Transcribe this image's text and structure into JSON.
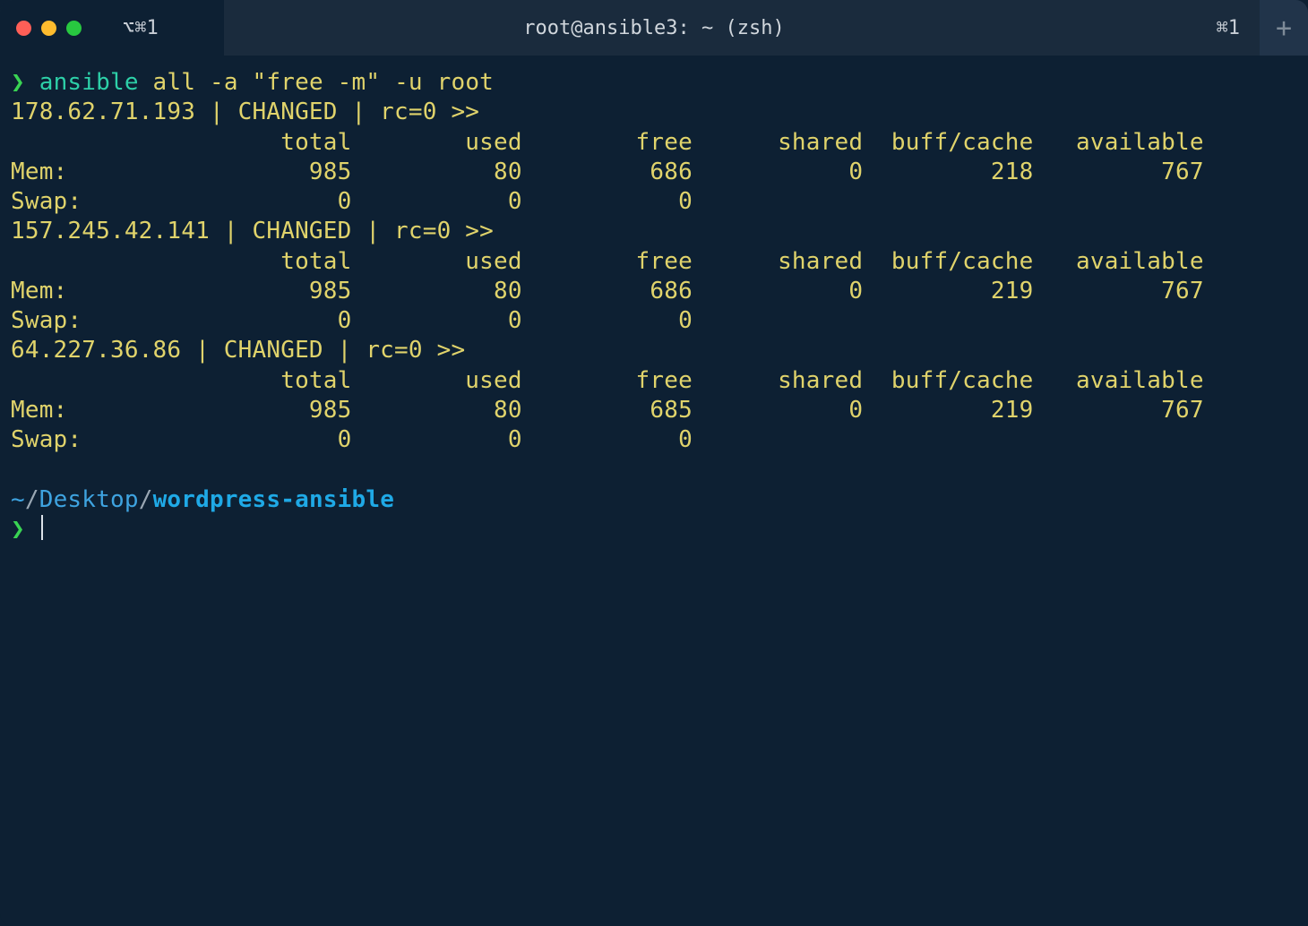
{
  "titlebar": {
    "tab_shortcut": "⌥⌘1",
    "window_title": "root@ansible3: ~ (zsh)",
    "right_shortcut": "⌘1",
    "new_tab_glyph": "+"
  },
  "prompt": {
    "arrow": "❯",
    "command_token": "ansible",
    "command_rest": " all -a \"free -m\" -u root"
  },
  "hosts": [
    {
      "ip": "178.62.71.193",
      "status": "CHANGED",
      "rc": "rc=0",
      "tail": ">>",
      "header": [
        "total",
        "used",
        "free",
        "shared",
        "buff/cache",
        "available"
      ],
      "rows": [
        {
          "label": "Mem:",
          "cells": [
            "985",
            "80",
            "686",
            "0",
            "218",
            "767"
          ]
        },
        {
          "label": "Swap:",
          "cells": [
            "0",
            "0",
            "0"
          ]
        }
      ]
    },
    {
      "ip": "157.245.42.141",
      "status": "CHANGED",
      "rc": "rc=0",
      "tail": ">>",
      "header": [
        "total",
        "used",
        "free",
        "shared",
        "buff/cache",
        "available"
      ],
      "rows": [
        {
          "label": "Mem:",
          "cells": [
            "985",
            "80",
            "686",
            "0",
            "219",
            "767"
          ]
        },
        {
          "label": "Swap:",
          "cells": [
            "0",
            "0",
            "0"
          ]
        }
      ]
    },
    {
      "ip": "64.227.36.86",
      "status": "CHANGED",
      "rc": "rc=0",
      "tail": ">>",
      "header": [
        "total",
        "used",
        "free",
        "shared",
        "buff/cache",
        "available"
      ],
      "rows": [
        {
          "label": "Mem:",
          "cells": [
            "985",
            "80",
            "685",
            "0",
            "219",
            "767"
          ]
        },
        {
          "label": "Swap:",
          "cells": [
            "0",
            "0",
            "0"
          ]
        }
      ]
    }
  ],
  "cwd": {
    "prefix": "~",
    "sep1": "/",
    "seg1": "Desktop",
    "sep2": "/",
    "seg2": "wordpress-ansible"
  }
}
